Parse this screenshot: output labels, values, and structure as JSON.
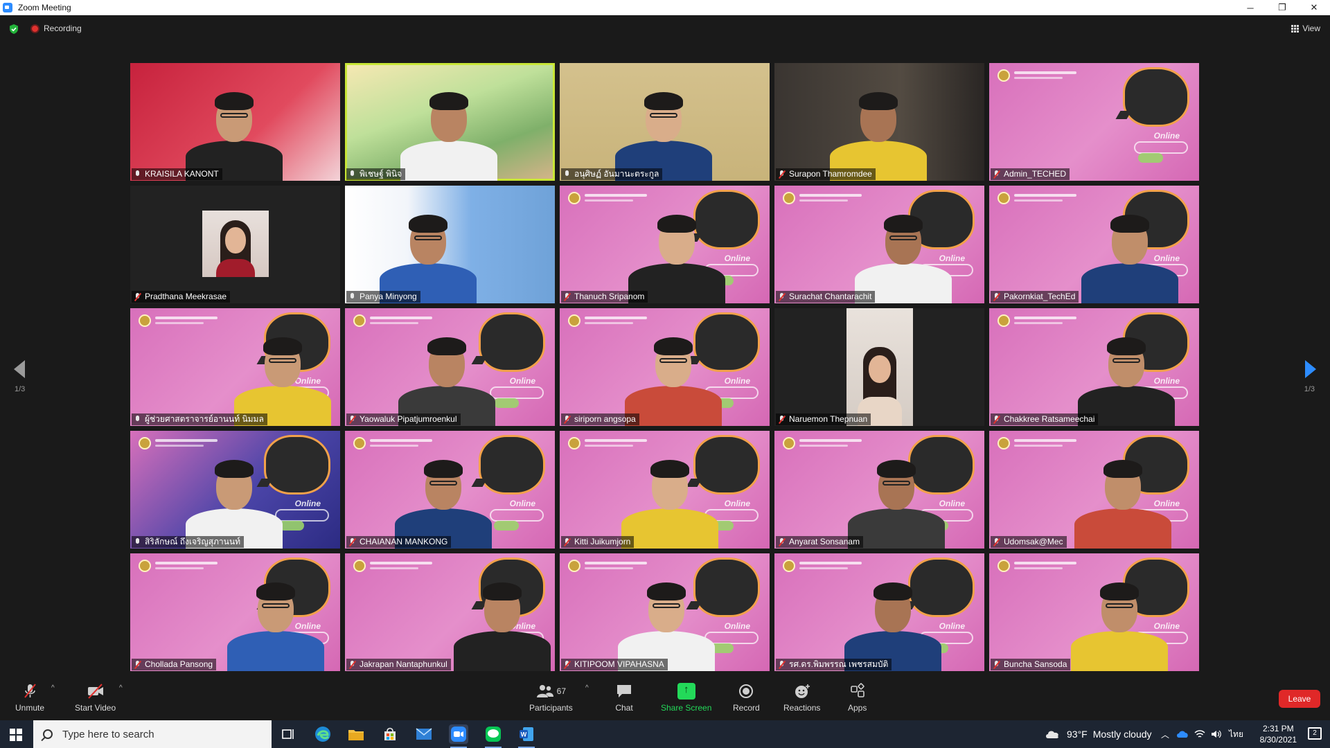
{
  "window": {
    "title": "Zoom Meeting",
    "controls": {
      "minimize": "─",
      "restore": "❐",
      "close": "✕"
    }
  },
  "topbar": {
    "recording_label": "Recording",
    "view_label": "View"
  },
  "gallery": {
    "page_left": "1/3",
    "page_right": "1/3",
    "participants": [
      {
        "name": "KRAISILA KANONT",
        "style": "red",
        "muted": false
      },
      {
        "name": "พิเชษฐ์ พินิจ",
        "style": "nature",
        "muted": false,
        "active_speaker": true
      },
      {
        "name": "อนุศิษฏ์ อันมานะตระกูล",
        "style": "room",
        "muted": false
      },
      {
        "name": "Surapon Thamromdee",
        "style": "shelf",
        "muted": true
      },
      {
        "name": "Admin_TECHED",
        "style": "pink",
        "muted": true,
        "empty_slide": true
      },
      {
        "name": "Pradthana Meekrasae",
        "style": "photo",
        "muted": true
      },
      {
        "name": "Panya Minyong",
        "style": "poster",
        "muted": false
      },
      {
        "name": "Thanuch Sripanom",
        "style": "pink",
        "muted": true
      },
      {
        "name": "Surachat Chantarachit",
        "style": "pink",
        "muted": true
      },
      {
        "name": "Pakornkiat_TechEd",
        "style": "pink",
        "muted": true
      },
      {
        "name": "ผู้ช่วยศาสตราจารย์อานนท์ นิมมล",
        "style": "pink",
        "muted": false
      },
      {
        "name": "Yaowaluk Pipatjumroenkul",
        "style": "pink",
        "muted": true
      },
      {
        "name": "siriporn angsopa",
        "style": "pink",
        "muted": true
      },
      {
        "name": "Naruemon Thepnuan",
        "style": "portrait",
        "muted": true
      },
      {
        "name": "Chakkree Ratsameechai",
        "style": "pink",
        "muted": true
      },
      {
        "name": "สิริลักษณ์ ถึงเจริญสุภานนท์",
        "style": "batik",
        "muted": false
      },
      {
        "name": "CHAIANAN MANKONG",
        "style": "pink",
        "muted": true
      },
      {
        "name": "Kitti Juikumjorn",
        "style": "pink",
        "muted": true
      },
      {
        "name": "Anyarat Sonsanam",
        "style": "pink",
        "muted": true
      },
      {
        "name": "Udomsak@Mec",
        "style": "pink",
        "muted": true
      },
      {
        "name": "Chollada Pansong",
        "style": "pink",
        "muted": true
      },
      {
        "name": "Jakrapan Nantaphunkul",
        "style": "pink",
        "muted": true
      },
      {
        "name": "KITIPOOM VIPAHASNA",
        "style": "pink",
        "muted": true
      },
      {
        "name": "รศ.ดร.พิมพรรณ เพชรสมบัติ",
        "style": "pink",
        "muted": true
      },
      {
        "name": "Buncha Sansoda",
        "style": "pink",
        "muted": true
      }
    ],
    "slide_online_text": "Online"
  },
  "toolbar": {
    "unmute_label": "Unmute",
    "start_video_label": "Start Video",
    "participants_label": "Participants",
    "participants_count": "67",
    "chat_label": "Chat",
    "share_screen_label": "Share Screen",
    "record_label": "Record",
    "reactions_label": "Reactions",
    "apps_label": "Apps",
    "leave_label": "Leave",
    "share_color": "#23d959",
    "leave_color": "#e02828"
  },
  "taskbar": {
    "search_placeholder": "Type here to search",
    "weather_temp": "93°F",
    "weather_text": "Mostly cloudy",
    "language": "ไทย",
    "time": "2:31 PM",
    "date": "8/30/2021",
    "notifications": "2",
    "apps": [
      "task-view-icon",
      "edge-icon",
      "file-explorer-icon",
      "store-icon",
      "mail-icon",
      "zoom-icon",
      "line-icon",
      "word-icon"
    ]
  }
}
